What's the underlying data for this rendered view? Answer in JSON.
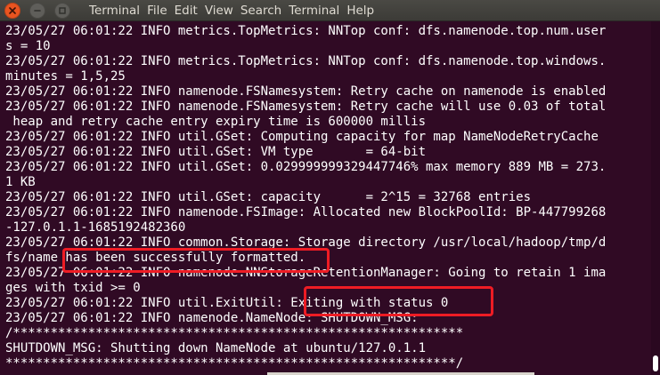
{
  "window": {
    "menu": [
      "Terminal",
      "File",
      "Edit",
      "View",
      "Search",
      "Terminal",
      "Help"
    ]
  },
  "colors": {
    "background": "#300a24",
    "text": "#ffffff",
    "highlight": "#ee1c24",
    "close_button": "#e95420"
  },
  "icons": {
    "close": "close-icon",
    "minimize": "minimize-icon",
    "maximize": "maximize-icon"
  },
  "log_lines": [
    "23/05/27 06:01:22 INFO metrics.TopMetrics: NNTop conf: dfs.namenode.top.num.user",
    "s = 10",
    "23/05/27 06:01:22 INFO metrics.TopMetrics: NNTop conf: dfs.namenode.top.windows.",
    "minutes = 1,5,25",
    "23/05/27 06:01:22 INFO namenode.FSNamesystem: Retry cache on namenode is enabled",
    "23/05/27 06:01:22 INFO namenode.FSNamesystem: Retry cache will use 0.03 of total",
    " heap and retry cache entry expiry time is 600000 millis",
    "23/05/27 06:01:22 INFO util.GSet: Computing capacity for map NameNodeRetryCache",
    "23/05/27 06:01:22 INFO util.GSet: VM type       = 64-bit",
    "23/05/27 06:01:22 INFO util.GSet: 0.029999999329447746% max memory 889 MB = 273.",
    "1 KB",
    "23/05/27 06:01:22 INFO util.GSet: capacity      = 2^15 = 32768 entries",
    "23/05/27 06:01:22 INFO namenode.FSImage: Allocated new BlockPoolId: BP-447799268",
    "-127.0.1.1-1685192482360",
    "23/05/27 06:01:22 INFO common.Storage: Storage directory /usr/local/hadoop/tmp/d",
    "fs/name has been successfully formatted.",
    "23/05/27 06:01:22 INFO namenode.NNStorageRetentionManager: Going to retain 1 ima",
    "ges with txid >= 0",
    "23/05/27 06:01:22 INFO util.ExitUtil: Exiting with status 0",
    "23/05/27 06:01:22 INFO namenode.NameNode: SHUTDOWN_MSG:",
    "/************************************************************",
    "SHUTDOWN_MSG: Shutting down NameNode at ubuntu/127.0.1.1",
    "************************************************************/"
  ]
}
